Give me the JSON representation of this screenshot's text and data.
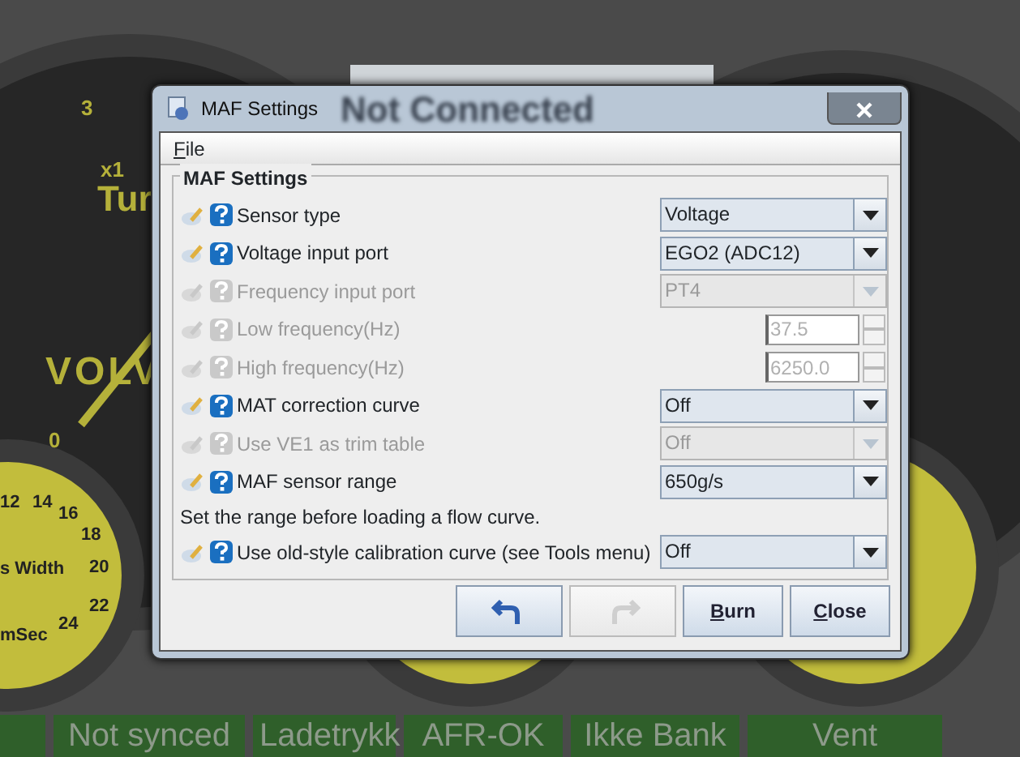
{
  "dashboard": {
    "banner": "Not Connected",
    "gauge_texts": [
      {
        "text": "3",
        "kind": "tick"
      },
      {
        "text": "x1",
        "kind": "tick"
      },
      {
        "text": "Tur",
        "kind": "title"
      },
      {
        "text": "VOLV",
        "kind": "brand"
      },
      {
        "text": "0",
        "kind": "tick"
      },
      {
        "text": "12",
        "kind": "small"
      },
      {
        "text": "14",
        "kind": "small"
      },
      {
        "text": "16",
        "kind": "small"
      },
      {
        "text": "18",
        "kind": "small"
      },
      {
        "text": "20",
        "kind": "small"
      },
      {
        "text": "22",
        "kind": "small"
      },
      {
        "text": "24",
        "kind": "small"
      },
      {
        "text": "s Width",
        "kind": "label"
      },
      {
        "text": "mSec",
        "kind": "label"
      }
    ]
  },
  "status_bar": [
    {
      "kind": "empty"
    },
    {
      "text": "Not synced"
    },
    {
      "text": "Ladetrykk"
    },
    {
      "text": "AFR-OK"
    },
    {
      "text": "Ikke Bank"
    },
    {
      "text": "Vent"
    }
  ],
  "window": {
    "title": "MAF Settings"
  },
  "menu": [
    "File"
  ],
  "group": {
    "title": "MAF Settings",
    "rows": [
      {
        "kind": "combo",
        "label": "Sensor type",
        "value": "Voltage",
        "disabled": false
      },
      {
        "kind": "combo",
        "label": "Voltage input port",
        "value": "EGO2 (ADC12)",
        "disabled": false
      },
      {
        "kind": "combo",
        "label": "Frequency input port",
        "value": "PT4",
        "disabled": true
      },
      {
        "kind": "spinner",
        "label": "Low frequency(Hz)",
        "value": "37.5",
        "disabled": true
      },
      {
        "kind": "spinner",
        "label": "High frequency(Hz)",
        "value": "6250.0",
        "disabled": true
      },
      {
        "kind": "combo",
        "label": "MAT correction curve",
        "value": "Off",
        "disabled": false
      },
      {
        "kind": "combo",
        "label": "Use VE1 as trim table",
        "value": "Off",
        "disabled": true
      },
      {
        "kind": "combo",
        "label": "MAF sensor range",
        "value": "650g/s",
        "disabled": false
      },
      {
        "kind": "note",
        "label": "Set the range before loading a flow curve."
      },
      {
        "kind": "combo",
        "label": "Use old-style calibration curve (see Tools menu)",
        "value": "Off",
        "disabled": false
      }
    ]
  },
  "buttons": [
    {
      "kind": "undo",
      "disabled": false
    },
    {
      "kind": "redo",
      "disabled": true
    },
    {
      "kind": "text",
      "label": "Burn",
      "disabled": false
    },
    {
      "kind": "text",
      "label": "Close",
      "disabled": false
    }
  ]
}
